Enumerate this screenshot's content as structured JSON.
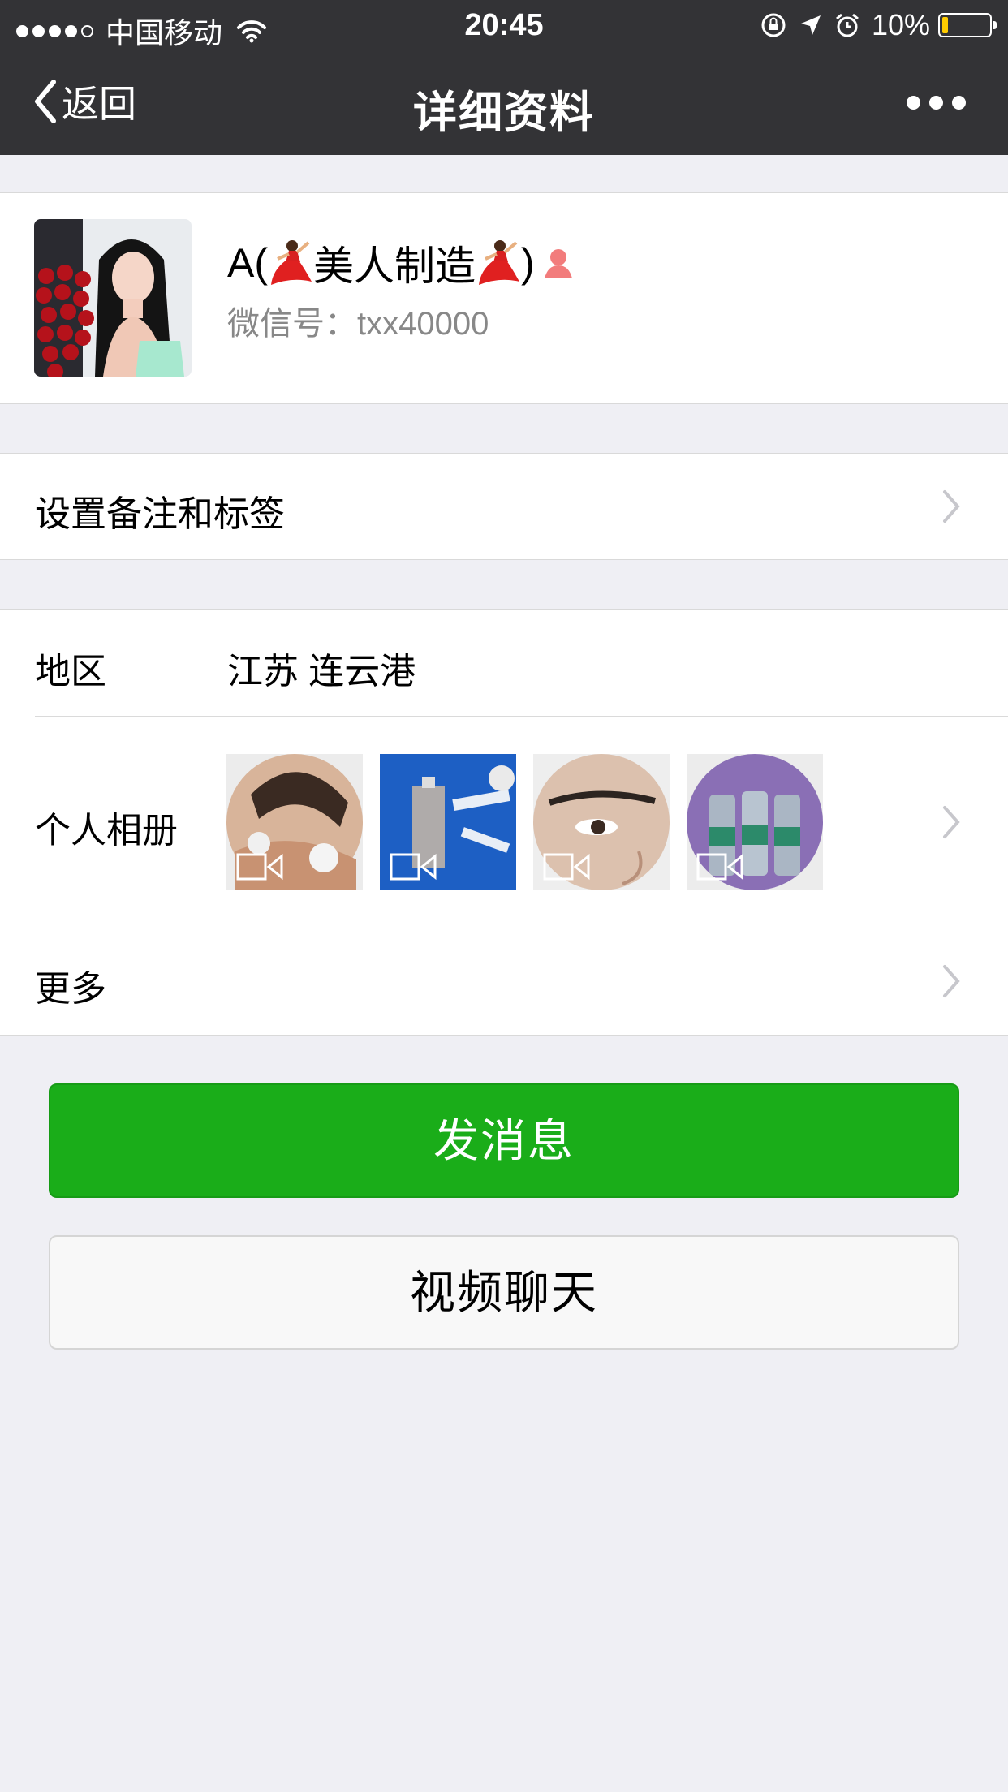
{
  "status_bar": {
    "carrier": "中国移动",
    "time": "20:45",
    "battery_percent": "10%",
    "battery_level": 0.1,
    "icons": [
      "signal-dots-icon",
      "wifi-icon",
      "rotation-lock-icon",
      "location-arrow-icon",
      "alarm-icon",
      "battery-icon"
    ]
  },
  "nav": {
    "back_label": "返回",
    "title": "详细资料",
    "more_icon": "ellipsis-icon"
  },
  "profile": {
    "name": "A(💃美人制造💃)",
    "name_prefix": "A(",
    "name_middle": "美人制造",
    "name_suffix": ")",
    "gender_icon": "female-icon",
    "wechat_label": "微信号：",
    "wechat_id": "txx40000"
  },
  "remark_cell": {
    "label": "设置备注和标签"
  },
  "region_cell": {
    "label": "地区",
    "value": "江苏 连云港"
  },
  "album_cell": {
    "label": "个人相册",
    "photos": [
      {
        "name": "photo-thumb-1",
        "has_video": true
      },
      {
        "name": "photo-thumb-2",
        "has_video": true
      },
      {
        "name": "photo-thumb-3",
        "has_video": true
      },
      {
        "name": "photo-thumb-4",
        "has_video": true
      }
    ]
  },
  "more_cell": {
    "label": "更多"
  },
  "buttons": {
    "send_message": "发消息",
    "video_chat": "视频聊天"
  },
  "colors": {
    "nav_bg": "#333336",
    "page_bg": "#efeff4",
    "primary_green": "#1aad19",
    "battery_yellow": "#ffcc00"
  }
}
